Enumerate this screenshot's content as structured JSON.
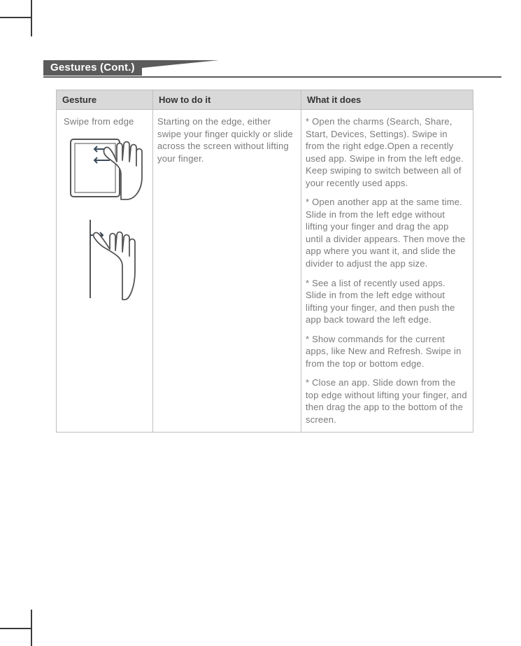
{
  "section_title": "Gestures (Cont.)",
  "table": {
    "headers": {
      "gesture": "Gesture",
      "how": "How to do it",
      "what": "What it does"
    },
    "row": {
      "gesture_label": "Swipe from edge",
      "how": "Starting on the edge, either swipe your finger quickly or slide across the screen without lifting your finger.",
      "what": [
        "* Open the charms (Search, Share, Start, Devices, Settings). Swipe in from the right edge.Open a recently used app. Swipe in from the left edge. Keep swiping to switch between all of your recently used apps.",
        "* Open another app at the same time. Slide in from the left edge without lifting your finger and drag the app until a divider appears. Then move the app where you want it, and slide the divider to adjust the app size.",
        "* See a list of recently used apps. Slide in from the left edge without lifting your finger, and then push the app back toward the left edge.",
        "* Show commands for the current apps, like New and Refresh. Swipe in from the top or bottom edge.",
        "* Close an app. Slide down from the top edge without lifting your finger, and then drag the app to the bottom of the screen."
      ]
    }
  }
}
